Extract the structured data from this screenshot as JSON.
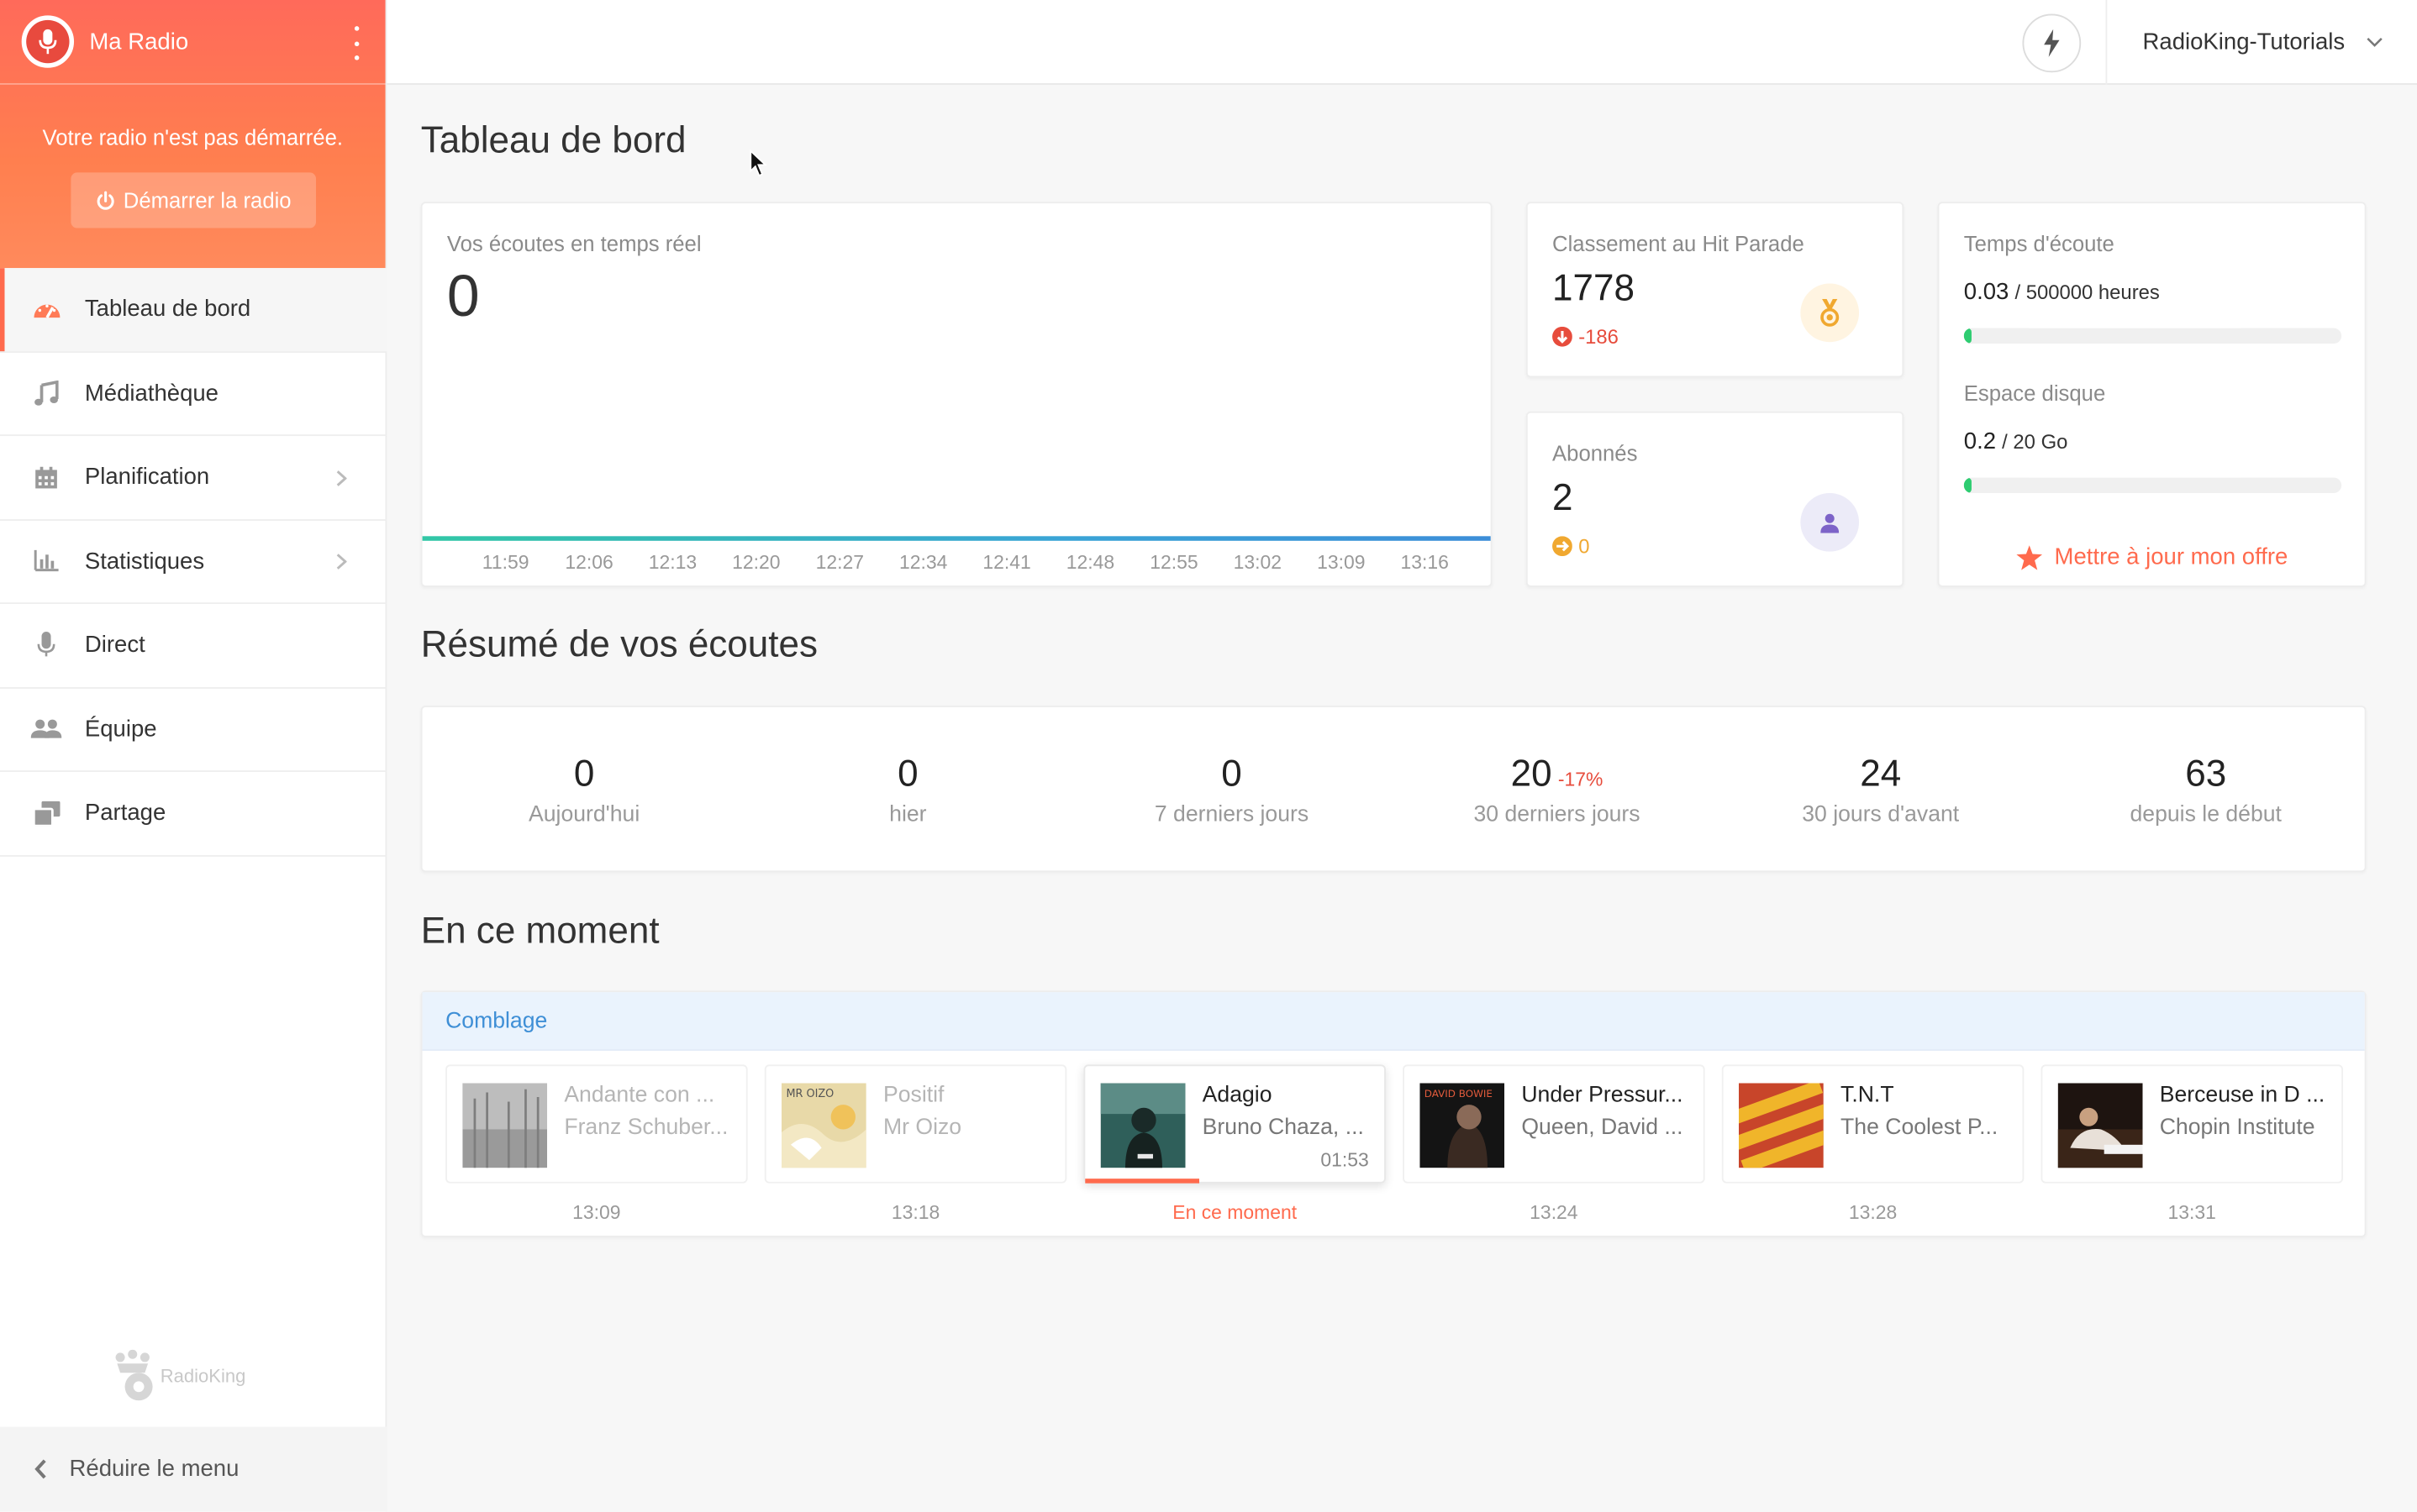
{
  "sidebar": {
    "brand_name": "Ma Radio",
    "radio_status": "Votre radio n'est pas démarrée.",
    "start_button": "Démarrer la radio",
    "items": [
      {
        "label": "Tableau de bord",
        "icon": "gauge-icon",
        "active": true
      },
      {
        "label": "Médiathèque",
        "icon": "music-note-icon"
      },
      {
        "label": "Planification",
        "icon": "calendar-icon",
        "has_submenu": true
      },
      {
        "label": "Statistiques",
        "icon": "bar-chart-icon",
        "has_submenu": true
      },
      {
        "label": "Direct",
        "icon": "microphone-icon"
      },
      {
        "label": "Équipe",
        "icon": "users-icon"
      },
      {
        "label": "Partage",
        "icon": "share-icon"
      }
    ],
    "footer_logo": "RadioKing",
    "collapse_label": "Réduire le menu"
  },
  "topbar": {
    "account_name": "RadioKing-Tutorials"
  },
  "dashboard": {
    "title": "Tableau de bord",
    "realtime": {
      "label": "Vos écoutes en temps réel",
      "value": "0",
      "ticks": [
        "11:59",
        "12:06",
        "12:13",
        "12:20",
        "12:27",
        "12:34",
        "12:41",
        "12:48",
        "12:55",
        "13:02",
        "13:09",
        "13:16"
      ]
    },
    "hit_parade": {
      "label": "Classement au Hit Parade",
      "value": "1778",
      "delta": "-186"
    },
    "subscribers": {
      "label": "Abonnés",
      "value": "2",
      "delta": "0"
    },
    "listening_time": {
      "label": "Temps d'écoute",
      "value": "0.03",
      "suffix": "/ 500000 heures",
      "fill": 1e-05
    },
    "disk_space": {
      "label": "Espace disque",
      "value": "0.2",
      "suffix": "/ 20 Go",
      "fill": 0.01
    },
    "upgrade_label": "Mettre à jour mon offre"
  },
  "summary": {
    "title": "Résumé de vos écoutes",
    "items": [
      {
        "value": "0",
        "label": "Aujourd'hui",
        "delta": ""
      },
      {
        "value": "0",
        "label": "hier",
        "delta": ""
      },
      {
        "value": "0",
        "label": "7 derniers jours",
        "delta": ""
      },
      {
        "value": "20",
        "label": "30 derniers jours",
        "delta": "-17%"
      },
      {
        "value": "24",
        "label": "30 jours d'avant",
        "delta": ""
      },
      {
        "value": "63",
        "label": "depuis le début",
        "delta": ""
      }
    ]
  },
  "now_playing": {
    "title": "En ce moment",
    "playlist": "Comblage",
    "tracks": [
      {
        "title": "Andante con ...",
        "artist": "Franz Schuber...",
        "time": "13:09",
        "state": "past",
        "duration": ""
      },
      {
        "title": "Positif",
        "artist": "Mr Oizo",
        "time": "13:18",
        "state": "past",
        "duration": ""
      },
      {
        "title": "Adagio",
        "artist": "Bruno Chaza, ...",
        "time": "En ce moment",
        "state": "current",
        "duration": "01:53"
      },
      {
        "title": "Under Pressur...",
        "artist": "Queen, David ...",
        "time": "13:24",
        "state": "future",
        "duration": ""
      },
      {
        "title": "T.N.T",
        "artist": "The Coolest P...",
        "time": "13:28",
        "state": "future",
        "duration": ""
      },
      {
        "title": "Berceuse in D ...",
        "artist": "Chopin Institute",
        "time": "13:31",
        "state": "future",
        "duration": ""
      }
    ],
    "cover_texts": {
      "positif": "MR OIZO",
      "under_pressure": "DAVID BOWIE"
    }
  },
  "colors": {
    "accent": "#ff6a4d",
    "header_gradient_start": "#ff6a5a",
    "header_gradient_end": "#ff8a5c",
    "link_blue": "#3f8fd6",
    "success": "#2ecc71"
  }
}
